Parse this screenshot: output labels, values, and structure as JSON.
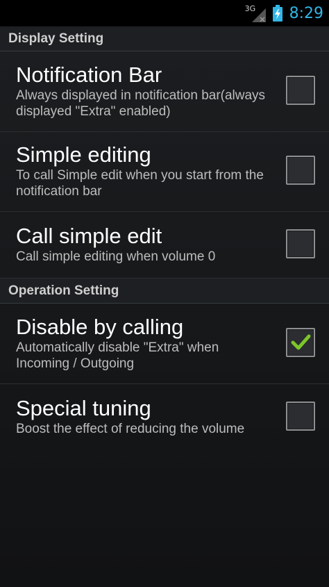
{
  "status_bar": {
    "network_type": "3G",
    "time": "8:29"
  },
  "sections": [
    {
      "header": "Display Setting",
      "items": [
        {
          "title": "Notification Bar",
          "summary": "Always displayed in notification bar(always displayed \"Extra\" enabled)",
          "checked": false
        },
        {
          "title": "Simple editing",
          "summary": "To call Simple edit when you start from the notification bar",
          "checked": false
        },
        {
          "title": "Call simple edit",
          "summary": "Call simple editing when volume 0",
          "checked": false
        }
      ]
    },
    {
      "header": "Operation Setting",
      "items": [
        {
          "title": "Disable by calling",
          "summary": "Automatically disable \"Extra\" when Incoming / Outgoing",
          "checked": true
        },
        {
          "title": "Special tuning",
          "summary": "Boost the effect of reducing the volume",
          "checked": false
        }
      ]
    }
  ],
  "colors": {
    "clock": "#33b5e5",
    "check": "#7cc62a",
    "battery": "#33b5e5"
  }
}
